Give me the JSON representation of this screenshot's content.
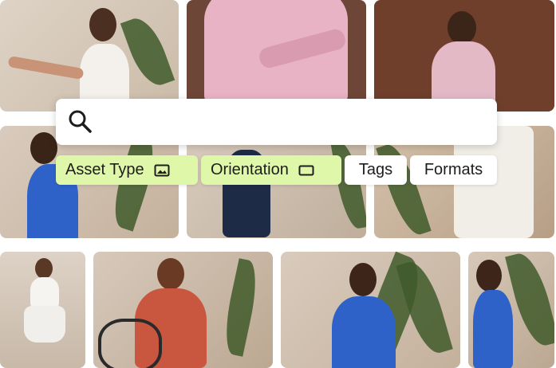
{
  "search": {
    "placeholder": "",
    "value": "",
    "icon": "search-icon"
  },
  "filters": [
    {
      "label": "Asset Type",
      "icon": "image-icon",
      "active": true
    },
    {
      "label": "Orientation",
      "icon": "rectangle-icon",
      "active": true
    },
    {
      "label": "Tags",
      "icon": "",
      "active": false
    },
    {
      "label": "Formats",
      "icon": "",
      "active": false
    }
  ],
  "colors": {
    "active_chip": "#dff7a8",
    "chip_text": "#1d1d1d"
  }
}
